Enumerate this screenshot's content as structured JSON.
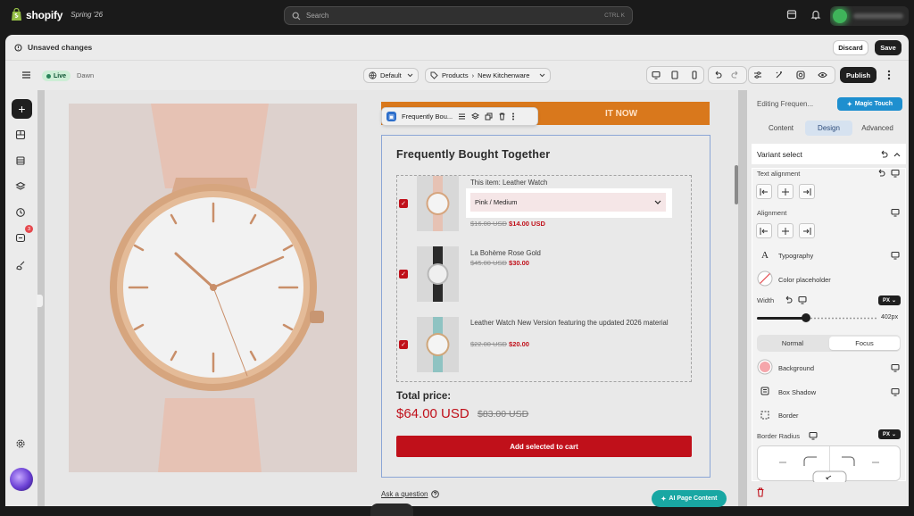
{
  "topbar": {
    "brand": "shopify",
    "edition": "Spring '26",
    "search_placeholder": "Search",
    "search_shortcut": "CTRL K"
  },
  "unsaved": {
    "title": "Unsaved changes",
    "discard": "Discard",
    "save": "Save"
  },
  "editor": {
    "status": "Live",
    "theme": "Dawn",
    "template": "Default",
    "breadcrumb_parent": "Products",
    "breadcrumb_child": "New Kitchenware",
    "publish": "Publish"
  },
  "canvas": {
    "banner_text": "IT NOW",
    "block_toolbar_label": "Frequently Bou...",
    "section_title": "Frequently Bought Together",
    "items": [
      {
        "prefix": "This item:",
        "name": "Leather Watch",
        "old_price": "$16.00 USD",
        "new_price": "$14.00 USD"
      },
      {
        "name": "La Bohème Rose Gold",
        "old_price": "$45.00 USD",
        "new_price": "$30.00"
      },
      {
        "name": "Leather Watch New Version featuring the updated 2026 material",
        "old_price": "$22.00 USD",
        "new_price": "$20.00"
      }
    ],
    "variant_value": "Pink / Medium",
    "total_label": "Total price:",
    "total_value": "$64.00 USD",
    "total_old": "$83.00 USD",
    "cart_button": "Add selected to cart",
    "ask_link": "Ask a question",
    "ai_button": "AI Page Content"
  },
  "panel": {
    "editing": "Editing Frequen...",
    "magic": "Magic Touch",
    "tabs": [
      "Content",
      "Design",
      "Advanced"
    ],
    "active_tab": "Design",
    "section": "Variant select",
    "text_alignment": "Text alignment",
    "alignment": "Alignment",
    "typography": "Typography",
    "color_placeholder": "Color placeholder",
    "width": "Width",
    "width_unit": "PX",
    "width_value": "402px",
    "width_fraction": 0.4,
    "state_tabs": [
      "Normal",
      "Focus"
    ],
    "active_state": "Focus",
    "background": "Background",
    "box_shadow": "Box Shadow",
    "border": "Border",
    "border_radius": "Border Radius",
    "border_radius_unit": "PX"
  },
  "colors": {
    "accent_red": "#c0101a",
    "banner_orange": "#d9781c",
    "magic_blue": "#1e8fcf",
    "ai_teal": "#19a7a3",
    "live_green": "#29845a"
  },
  "icons": [
    "shopify-bag-icon",
    "search-icon",
    "store-icon",
    "bell-icon",
    "menu-icon",
    "globe-icon",
    "tag-icon",
    "chevron-down-icon",
    "desktop-icon",
    "tablet-icon",
    "mobile-icon",
    "undo-icon",
    "redo-icon",
    "sliders-icon",
    "magic-icon",
    "inspect-icon",
    "eye-icon",
    "more-icon",
    "plus-icon",
    "sections-icon",
    "layers-icon",
    "history-icon",
    "chat-icon",
    "gear-icon",
    "trash-icon",
    "reset-icon",
    "chevron-up-icon",
    "align-left-icon",
    "align-center-icon",
    "align-right-icon",
    "link-icon"
  ]
}
